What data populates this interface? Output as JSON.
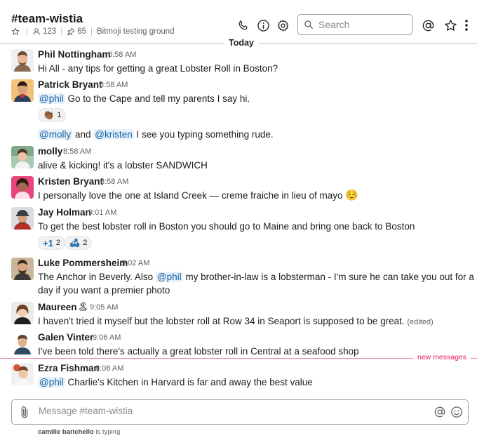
{
  "channel": {
    "name": "#team-wistia",
    "member_count": "123",
    "pinned_count": "65",
    "topic": "Bitmoji testing ground"
  },
  "search": {
    "placeholder": "Search"
  },
  "divider": {
    "today": "Today",
    "new_messages": "new messages"
  },
  "icons": {
    "header": [
      "star-icon",
      "members-icon",
      "pin-icon",
      "phone-icon",
      "info-icon",
      "gear-icon",
      "search-icon",
      "at-icon",
      "star-icon",
      "more-icon"
    ],
    "composer": [
      "paperclip-icon",
      "at-icon",
      "emoji-icon"
    ]
  },
  "messages": [
    {
      "author": "Phil Nottingham",
      "time": "8:58 AM",
      "text": "Hi All - any tips for getting a great Lobster Roll in Boston?"
    },
    {
      "author": "Patrick Bryant",
      "time": "8:58 AM",
      "mention": "@phil",
      "text": "Go to the Cape and tell my parents I say hi.",
      "reactions": [
        {
          "emoji": "👏🏾",
          "count": "1"
        }
      ],
      "followup": {
        "mention1": "@molly",
        "and": "and",
        "mention2": "@kristen",
        "text": "I see you typing something rude."
      }
    },
    {
      "author": "molly",
      "time": "8:58 AM",
      "text": "alive & kicking! it's a lobster SANDWICH"
    },
    {
      "author": "Kristen Bryant",
      "time": "8:58 AM",
      "text": "I personally love the one at Island Creek — creme fraiche in lieu of mayo",
      "emoji": "☺️"
    },
    {
      "author": "Jay Holman",
      "time": "9:01 AM",
      "text": "To get the best lobster roll in Boston you should go to Maine and bring one back to Boston",
      "reactions": [
        {
          "emoji": "+1",
          "count": "2"
        },
        {
          "emoji": "🛋",
          "count": "2"
        }
      ]
    },
    {
      "author": "Luke Pommersheim",
      "time": "9:02 AM",
      "text1": "The Anchor in Beverly. Also",
      "mention": "@phil",
      "text2": "my brother-in-law is a lobsterman - I'm sure he can take you out for a",
      "text3": "day if you want a premier photo"
    },
    {
      "author": "Maureen",
      "status_emoji": "🏝",
      "time": "9:05 AM",
      "text": "I haven't tried it myself but the lobster roll at Row 34 in Seaport is supposed to be great.",
      "edited": "(edited)"
    },
    {
      "author": "Galen Vinter",
      "time": "9:06 AM",
      "text": "I've been told there's actually a great lobster roll in Central at a seafood shop"
    },
    {
      "author": "Ezra Fishman",
      "time": "9:08 AM",
      "mention": "@phil",
      "text": "Charlie's Kitchen in Harvard is far and away the best value"
    }
  ],
  "composer": {
    "placeholder": "Message #team-wistia"
  },
  "typing": {
    "user": "camille barichello",
    "suffix": "is typing"
  },
  "colors": {
    "mention_bg": "#e8f0fa",
    "mention_text": "#1264a3",
    "new_messages": "#e01e5a",
    "text": "#1d1c1d",
    "muted": "#616061"
  }
}
